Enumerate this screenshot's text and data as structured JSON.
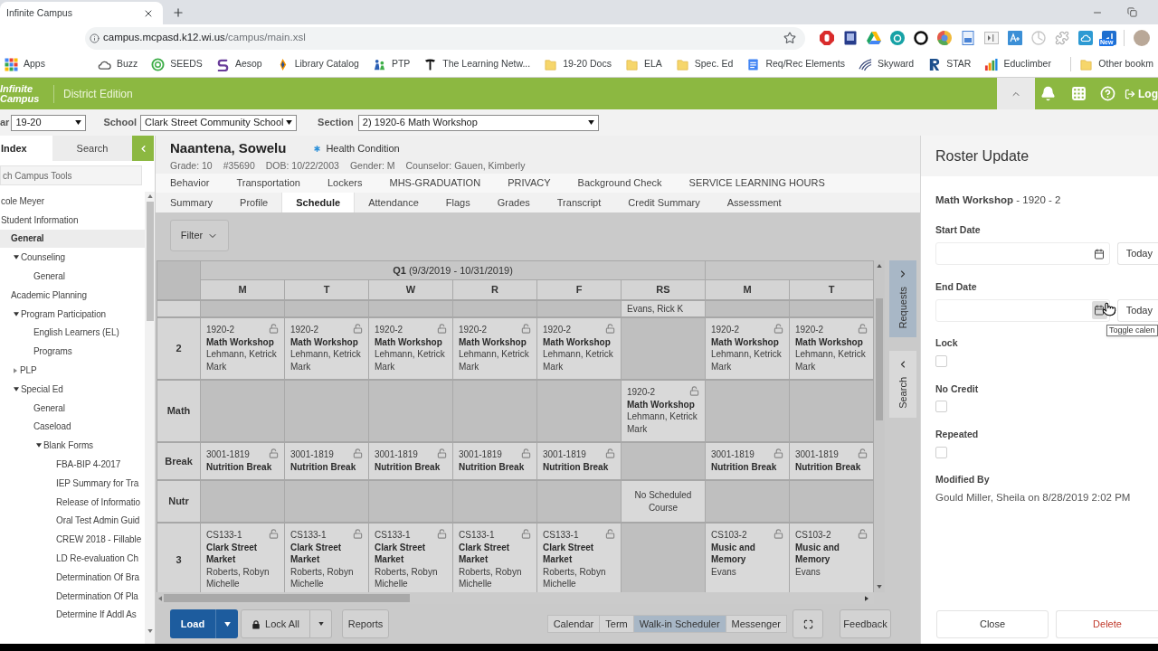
{
  "browser": {
    "tab_title": "Infinite Campus",
    "url_host": "campus.mcpasd.k12.wi.us",
    "url_path": "/campus/main.xsl",
    "extension_badge": "New",
    "bookmarks": [
      {
        "label": "Apps",
        "kind": "apps"
      },
      {
        "label": "Buzz",
        "kind": "buzz"
      },
      {
        "label": "SEEDS",
        "kind": "seeds"
      },
      {
        "label": "Aesop",
        "kind": "aesop"
      },
      {
        "label": "Library Catalog",
        "kind": "library"
      },
      {
        "label": "PTP",
        "kind": "ptp"
      },
      {
        "label": "The Learning Netw...",
        "kind": "news"
      },
      {
        "label": "19-20 Docs",
        "kind": "folder"
      },
      {
        "label": "ELA",
        "kind": "folder"
      },
      {
        "label": "Spec. Ed",
        "kind": "folder"
      },
      {
        "label": "Req/Rec Elements",
        "kind": "doc"
      },
      {
        "label": "Skyward",
        "kind": "skyward"
      },
      {
        "label": "STAR",
        "kind": "star"
      },
      {
        "label": "Educlimber",
        "kind": "chart"
      }
    ],
    "other_bookmarks": {
      "label": "Other bookm",
      "kind": "folder"
    }
  },
  "header": {
    "logo": "Infinite Campus",
    "edition": "District Edition",
    "logout": "Log"
  },
  "context": {
    "year": {
      "label": "ar",
      "value": "19-20"
    },
    "school": {
      "label": "School",
      "value": "Clark Street Community School"
    },
    "section": {
      "label": "Section",
      "value": "2) 1920-6 Math Workshop"
    }
  },
  "sidebar": {
    "tabs": [
      {
        "label": "Index",
        "selected": true
      },
      {
        "label": "Search",
        "selected": false
      }
    ],
    "search_placeholder": "ch Campus Tools",
    "tree": [
      {
        "label": "cole Meyer",
        "selected": false
      },
      {
        "label": "Student Information",
        "selected": false,
        "children": [
          {
            "label": "General",
            "selected": true
          },
          {
            "label": "Counseling",
            "selected": false,
            "expanded": true,
            "children": [
              {
                "label": "General",
                "selected": false
              }
            ]
          },
          {
            "label": "Academic Planning",
            "selected": false
          },
          {
            "label": "Program Participation",
            "selected": false,
            "expanded": true,
            "children": [
              {
                "label": "English Learners (EL)",
                "selected": false
              },
              {
                "label": "Programs",
                "selected": false
              }
            ]
          },
          {
            "label": "PLP",
            "selected": false,
            "expanded": false
          },
          {
            "label": "Special Ed",
            "selected": false,
            "expanded": true,
            "children": [
              {
                "label": "General",
                "selected": false
              },
              {
                "label": "Caseload",
                "selected": false
              },
              {
                "label": "Blank Forms",
                "selected": false,
                "expanded": true,
                "children": [
                  {
                    "label": "FBA-BIP 4-2017",
                    "selected": false
                  },
                  {
                    "label": "IEP Summary for Tra",
                    "selected": false
                  },
                  {
                    "label": "Release of Informatio",
                    "selected": false
                  },
                  {
                    "label": "Oral Test Admin Guid",
                    "selected": false
                  },
                  {
                    "label": "CREW 2018 - Fillable",
                    "selected": false
                  },
                  {
                    "label": "LD Re-evaluation Ch",
                    "selected": false
                  },
                  {
                    "label": "Determination Of Bra",
                    "selected": false
                  },
                  {
                    "label": "Determination Of Pla",
                    "selected": false
                  },
                  {
                    "label": "Determine If Addl As",
                    "selected": false
                  }
                ]
              }
            ]
          }
        ]
      }
    ]
  },
  "student": {
    "name": "Naantena, Sowelu",
    "alert": "Health Condition",
    "details": [
      "Grade: 10",
      "#35690",
      "DOB: 10/22/2003",
      "Gender: M",
      "Counselor: Gauen, Kimberly"
    ]
  },
  "tab_bars": [
    {
      "tabs": [
        {
          "label": "Behavior",
          "selected": false
        },
        {
          "label": "Transportation",
          "selected": false
        },
        {
          "label": "Lockers",
          "selected": false
        },
        {
          "label": "MHS-GRADUATION",
          "selected": false
        },
        {
          "label": "PRIVACY",
          "selected": false
        },
        {
          "label": "Background Check",
          "selected": false
        },
        {
          "label": "SERVICE LEARNING HOURS",
          "selected": false
        }
      ]
    },
    {
      "tabs": [
        {
          "label": "Summary",
          "selected": false
        },
        {
          "label": "Profile",
          "selected": false
        },
        {
          "label": "Schedule",
          "selected": true
        },
        {
          "label": "Attendance",
          "selected": false
        },
        {
          "label": "Flags",
          "selected": false
        },
        {
          "label": "Grades",
          "selected": false
        },
        {
          "label": "Transcript",
          "selected": false
        },
        {
          "label": "Credit Summary",
          "selected": false
        },
        {
          "label": "Assessment",
          "selected": false
        }
      ]
    }
  ],
  "schedule": {
    "filter": "Filter",
    "term": "**Q1** (9/3/2019 - 10/31/2019)",
    "days": [
      "M",
      "T",
      "W",
      "R",
      "F",
      "RS",
      "M",
      "T"
    ],
    "rows": [
      {
        "clipped": true,
        "cells": [
          {
            "kind": "empty"
          },
          {
            "kind": "empty"
          },
          {
            "kind": "empty"
          },
          {
            "kind": "empty"
          },
          {
            "kind": "empty"
          },
          {
            "kind": "teacher",
            "text": "Evans, Rick K"
          },
          {
            "kind": "empty"
          },
          {
            "kind": "empty"
          }
        ]
      },
      {
        "period": "2",
        "clipped": false,
        "cells": [
          {
            "kind": "course",
            "code": "1920-2",
            "title": "Math Workshop",
            "teacher": "Lehmann, Ketrick Mark",
            "locked": false
          },
          {
            "kind": "course",
            "code": "1920-2",
            "title": "Math Workshop",
            "teacher": "Lehmann, Ketrick Mark",
            "locked": false
          },
          {
            "kind": "course",
            "code": "1920-2",
            "title": "Math Workshop",
            "teacher": "Lehmann, Ketrick Mark",
            "locked": false
          },
          {
            "kind": "course",
            "code": "1920-2",
            "title": "Math Workshop",
            "teacher": "Lehmann, Ketrick Mark",
            "locked": false
          },
          {
            "kind": "course",
            "code": "1920-2",
            "title": "Math Workshop",
            "teacher": "Lehmann, Ketrick Mark",
            "locked": false
          },
          {
            "kind": "empty"
          },
          {
            "kind": "course",
            "code": "1920-2",
            "title": "Math Workshop",
            "teacher": "Lehmann, Ketrick Mark",
            "locked": false
          },
          {
            "kind": "course",
            "code": "1920-2",
            "title": "Math Workshop",
            "teacher": "Lehmann, Ketrick Mark",
            "locked": false
          }
        ]
      },
      {
        "period": "Math",
        "clipped": false,
        "cells": [
          {
            "kind": "empty"
          },
          {
            "kind": "empty"
          },
          {
            "kind": "empty"
          },
          {
            "kind": "empty"
          },
          {
            "kind": "empty"
          },
          {
            "kind": "course",
            "code": "1920-2",
            "title": "Math Workshop",
            "teacher": "Lehmann, Ketrick Mark",
            "locked": false
          },
          {
            "kind": "empty"
          },
          {
            "kind": "empty"
          }
        ]
      },
      {
        "period": "Break",
        "clipped": false,
        "cells": [
          {
            "kind": "course",
            "code": "3001-1819",
            "title": "Nutrition Break",
            "locked": false
          },
          {
            "kind": "course",
            "code": "3001-1819",
            "title": "Nutrition Break",
            "locked": false
          },
          {
            "kind": "course",
            "code": "3001-1819",
            "title": "Nutrition Break",
            "locked": false
          },
          {
            "kind": "course",
            "code": "3001-1819",
            "title": "Nutrition Break",
            "locked": false
          },
          {
            "kind": "course",
            "code": "3001-1819",
            "title": "Nutrition Break",
            "locked": false
          },
          {
            "kind": "empty"
          },
          {
            "kind": "course",
            "code": "3001-1819",
            "title": "Nutrition Break",
            "locked": false
          },
          {
            "kind": "course",
            "code": "3001-1819",
            "title": "Nutrition Break",
            "locked": false
          }
        ]
      },
      {
        "period": "Nutr",
        "clipped": false,
        "cells": [
          {
            "kind": "empty"
          },
          {
            "kind": "empty"
          },
          {
            "kind": "empty"
          },
          {
            "kind": "empty"
          },
          {
            "kind": "empty"
          },
          {
            "kind": "note",
            "text": "No Scheduled Course"
          },
          {
            "kind": "empty"
          },
          {
            "kind": "empty"
          }
        ]
      },
      {
        "period": "3",
        "clipped": false,
        "cells": [
          {
            "kind": "course",
            "code": "CS133-1",
            "title": "Clark Street Market",
            "teacher": "Roberts, Robyn Michelle",
            "locked": false
          },
          {
            "kind": "course",
            "code": "CS133-1",
            "title": "Clark Street Market",
            "teacher": "Roberts, Robyn Michelle",
            "locked": false
          },
          {
            "kind": "course",
            "code": "CS133-1",
            "title": "Clark Street Market",
            "teacher": "Roberts, Robyn Michelle",
            "locked": false
          },
          {
            "kind": "course",
            "code": "CS133-1",
            "title": "Clark Street Market",
            "teacher": "Roberts, Robyn Michelle",
            "locked": false
          },
          {
            "kind": "course",
            "code": "CS133-1",
            "title": "Clark Street Market",
            "teacher": "Roberts, Robyn Michelle",
            "locked": false
          },
          {
            "kind": "empty"
          },
          {
            "kind": "course",
            "code": "CS103-2",
            "title": "Music and Memory",
            "teacher": "Evans",
            "locked": false
          },
          {
            "kind": "course",
            "code": "CS103-2",
            "title": "Music and Memory",
            "teacher": "Evans",
            "locked": false
          }
        ]
      }
    ],
    "side_tabs": [
      {
        "label": "Requests",
        "selected": true
      },
      {
        "label": "Search",
        "selected": false
      }
    ]
  },
  "toolbar": {
    "load": "Load",
    "lock_all": "Lock All",
    "reports": "Reports",
    "views": [
      {
        "label": "Calendar",
        "selected": false
      },
      {
        "label": "Term",
        "selected": false
      },
      {
        "label": "Walk-in Scheduler",
        "selected": true
      },
      {
        "label": "Messenger",
        "selected": false
      }
    ],
    "feedback": "Feedback"
  },
  "roster": {
    "title": "Roster Update",
    "course": "**Math Workshop** - 1920 - 2",
    "date_fields": [
      {
        "label": "Start Date",
        "button": "Today",
        "hovered": false
      },
      {
        "label": "End Date",
        "button": "Today",
        "hovered": true
      }
    ],
    "tooltip": "Toggle calen",
    "checkboxes": [
      {
        "label": "Lock",
        "checked": false
      },
      {
        "label": "No Credit",
        "checked": false
      },
      {
        "label": "Repeated",
        "checked": false
      }
    ],
    "modified_label": "Modified By",
    "modified_value": "Gould Miller, Sheila on 8/28/2019 2:02 PM",
    "buttons": [
      {
        "label": "Close",
        "kind": "neutral"
      },
      {
        "label": "Delete",
        "kind": "danger"
      }
    ]
  }
}
